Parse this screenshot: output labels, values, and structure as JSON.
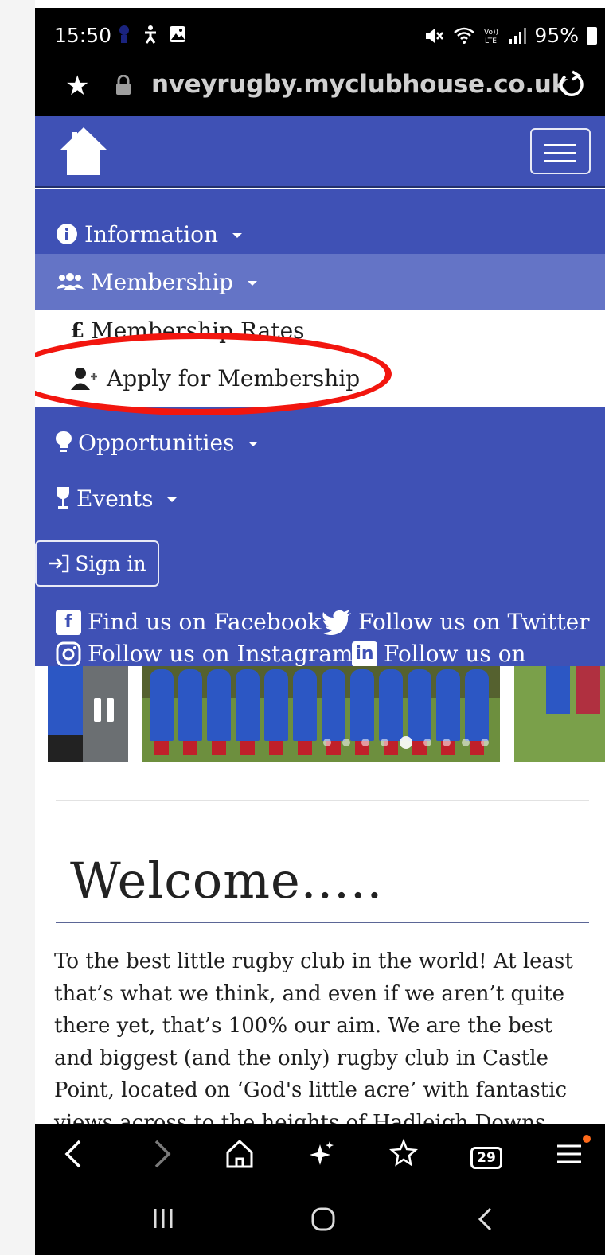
{
  "status_bar": {
    "time": "15:50",
    "battery": "95%"
  },
  "url_bar": {
    "url": "nveyrugby.myclubhouse.co.uk"
  },
  "nav": {
    "items": [
      {
        "label": "Information",
        "icon": "info-circle-icon"
      },
      {
        "label": "Membership",
        "icon": "users-icon"
      },
      {
        "label": "Opportunities",
        "icon": "lightbulb-icon"
      },
      {
        "label": "Events",
        "icon": "wine-glass-icon"
      }
    ],
    "membership_dropdown": [
      {
        "label": "Membership Rates",
        "icon": "pound-icon"
      },
      {
        "label": "Apply for Membership",
        "icon": "user-plus-icon"
      }
    ],
    "sign_in": "Sign in",
    "social": {
      "facebook": "Find us on Facebook",
      "twitter": "Follow us on Twitter",
      "instagram": "Follow us on Instagram",
      "linkedin": "Follow us on"
    }
  },
  "content": {
    "heading": "Welcome.....",
    "intro": "To the best little rugby club in the world! At least that’s what we think, and even if we aren’t quite there yet, that’s 100% our aim. We are the best and biggest (and the only) rugby club in Castle Point, located on ‘God's little acre’ with fantastic views across to the heights of Hadleigh Downs giving us"
  },
  "toolbar": {
    "tabs_count": "29"
  },
  "colors": {
    "nav_bg": "#3f51b5",
    "nav_active_bg": "#6474c6",
    "highlight": "#f2160f"
  }
}
